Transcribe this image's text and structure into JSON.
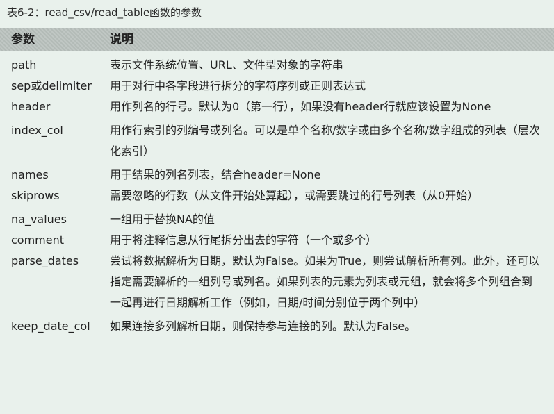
{
  "caption": "表6-2：read_csv/read_table函数的参数",
  "header": {
    "param": "参数",
    "desc": "说明"
  },
  "rows": [
    {
      "param": "path",
      "desc": "表示文件系统位置、URL、文件型对象的字符串"
    },
    {
      "param": "sep或delimiter",
      "desc": "用于对行中各字段进行拆分的字符序列或正则表达式"
    },
    {
      "param": "header",
      "desc": "用作列名的行号。默认为0（第一行），如果没有header行就应该设置为None"
    },
    {
      "param": "index_col",
      "desc": "用作行索引的列编号或列名。可以是单个名称/数字或由多个名称/数字组成的列表（层次化索引）"
    },
    {
      "param": "names",
      "desc": "用于结果的列名列表，结合header=None"
    },
    {
      "param": "skiprows",
      "desc": "需要忽略的行数（从文件开始处算起），或需要跳过的行号列表（从0开始）"
    },
    {
      "param": "na_values",
      "desc": "一组用于替换NA的值"
    },
    {
      "param": "comment",
      "desc": "用于将注释信息从行尾拆分出去的字符（一个或多个）"
    },
    {
      "param": "parse_dates",
      "desc": "尝试将数据解析为日期，默认为False。如果为True，则尝试解析所有列。此外，还可以指定需要解析的一组列号或列名。如果列表的元素为列表或元组，就会将多个列组合到一起再进行日期解析工作（例如，日期/时间分别位于两个列中）"
    },
    {
      "param": "keep_date_col",
      "desc": "如果连接多列解析日期，则保持参与连接的列。默认为False。"
    }
  ]
}
